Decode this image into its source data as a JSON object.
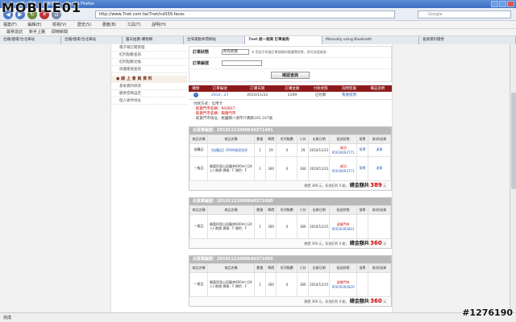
{
  "window": {
    "title": "7net 統一超商 — 訂單查詢 — Mozilla Firefox"
  },
  "nav": {
    "url": "http://www.7net.com.tw/7net/rui039.faces",
    "search_placeholder": "Google"
  },
  "menus": [
    "檔案(F)",
    "編輯(E)",
    "檢視(V)",
    "歷史(S)",
    "書籤(B)",
    "工具(T)",
    "說明(H)"
  ],
  "bookmarks": [
    "最常造訪",
    "新手上路",
    "即時新聞"
  ],
  "tabs": [
    {
      "label": "台鐵/捷運/台北車站",
      "active": false
    },
    {
      "label": "台鐵/捷運/台北車站",
      "active": false
    },
    {
      "label": "露天拍賣-購物網",
      "active": false
    },
    {
      "label": "台灣運動休閒網站",
      "active": false
    },
    {
      "label": "7net 統一超商 訂單查詢",
      "active": true
    },
    {
      "label": "Manually using Bluetooth",
      "active": false
    },
    {
      "label": "會員資料變更",
      "active": false
    }
  ],
  "sidebar": {
    "top_links": [
      "電子報訂閱管理",
      "紅利點數查詢",
      "紅利點數兌換",
      "詳盡帳號查詢"
    ],
    "section_title": "● 線 上 會 員 資 料",
    "section_links": [
      "基本資料修改",
      "變更密碼設定",
      "個人收件地址"
    ]
  },
  "filter": {
    "status_label": "訂單狀態",
    "status_value": "所有狀態",
    "status_note": "※ 您若不知道訂單號碼的請選擇狀態，即可快速查詢",
    "number_label": "訂單編號",
    "button_label": "確認查詢"
  },
  "order_table": {
    "headers": [
      "購物",
      "訂單編號",
      "訂購日期",
      "訂購金額",
      "付款狀態",
      "詢問客服",
      "備註說明"
    ],
    "row": {
      "number": "2010...27",
      "date": "2010/11/22",
      "amount": "1109",
      "pay_status": "已付款",
      "service": "我要提問"
    },
    "payment_lines": [
      "付款方式：信用卡",
      "‧ 取貨門市名稱：943817",
      "‧ 取貨門市名稱：興隆門市",
      "‧ 取貨門市地址：桃園縣八德市介壽路105,107號"
    ]
  },
  "shipments": [
    {
      "head": "出貨單編號：20101122000640271401",
      "headers": [
        "商品名稱",
        "商品名稱",
        "數量",
        "單價",
        "紅利點數",
        "小計",
        "出貨日期",
        "配送狀態",
        "發票",
        "取消/退貨"
      ],
      "rows": [
        {
          "type": "加購品",
          "name": "【加購品】OPEN鳥造型杯",
          "qty": "1",
          "price": "29",
          "bonus": "0",
          "subtotal": "29",
          "date": "2010/11/23",
          "status": "成功",
          "track": "95030093771",
          "invoice": "發票",
          "action": "退貨"
        },
        {
          "type": "一般品",
          "name": "開喜阿里山烏龍茶600ml (24入)-熱銷 規格：F 顏色：F",
          "qty": "1",
          "price": "360",
          "bonus": "0",
          "subtotal": "360",
          "date": "2010/11/23",
          "status": "成功",
          "track": "95030093771",
          "invoice": "發票",
          "action": "退貨"
        }
      ],
      "total_note": "總價 389 元，折抵紅利 0 點，",
      "total_label": "總金額共",
      "total_amount": "389",
      "total_unit": "元"
    },
    {
      "head": "出貨單編號：20101122000640271000",
      "headers": [
        "商品名稱",
        "商品名稱",
        "數量",
        "單價",
        "紅利點數",
        "小計",
        "出貨日期",
        "配送狀態",
        "發票",
        "取消/退貨"
      ],
      "rows": [
        {
          "type": "一般品",
          "name": "開喜阿里山烏龍茶600ml (24入)-熱銷 規格：F 顏色：F",
          "qty": "1",
          "price": "360",
          "bonus": "0",
          "subtotal": "360",
          "date": "2010/12/15",
          "status": "送貨門市",
          "track": "95030362821",
          "invoice": "",
          "action": ""
        }
      ],
      "total_note": "總價 360 元，折抵紅利 0 點，",
      "total_label": "總金額共",
      "total_amount": "360",
      "total_unit": "元"
    },
    {
      "head": "出貨單編號：20101122000640271000",
      "headers": [
        "商品名稱",
        "商品名稱",
        "數量",
        "單價",
        "紅利點數",
        "小計",
        "出貨日期",
        "配送狀態",
        "發票",
        "取消/退貨"
      ],
      "rows": [
        {
          "type": "一般品",
          "name": "開喜阿里山烏龍茶600ml (24入)-熱銷 規格：F 顏色：F",
          "qty": "1",
          "price": "360",
          "bonus": "0",
          "subtotal": "360",
          "date": "2010/12/15",
          "status": "送貨門市",
          "track": "95030362820",
          "invoice": "",
          "action": ""
        }
      ],
      "total_note": "總價 360 元，折抵紅利 0 點，",
      "total_label": "總金額共",
      "total_amount": "360",
      "total_unit": "元"
    }
  ],
  "status": {
    "text": "完成"
  },
  "watermark": {
    "logo": "MOBILE01",
    "photo_id": "#1276190"
  }
}
